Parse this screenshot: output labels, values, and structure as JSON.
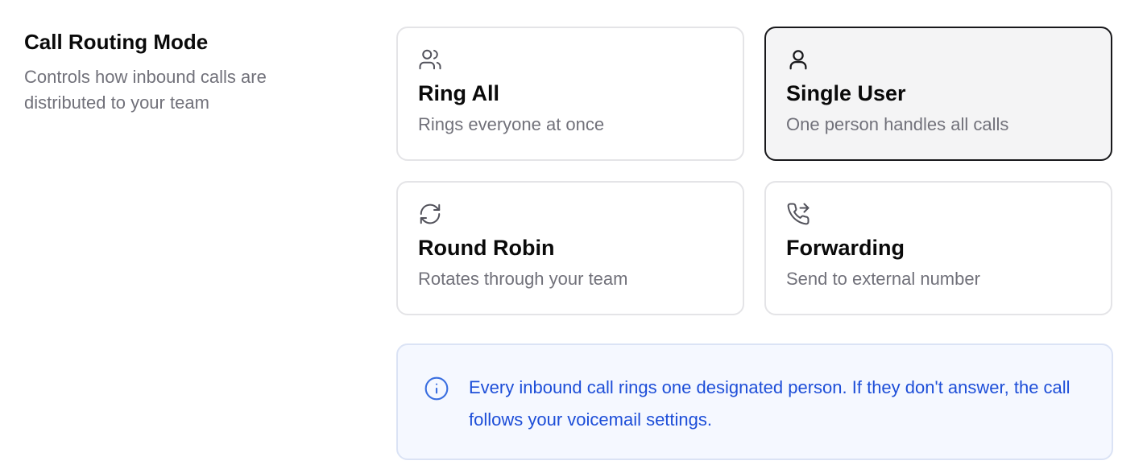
{
  "section": {
    "title": "Call Routing Mode",
    "description": "Controls how inbound calls are distributed to your team"
  },
  "options": [
    {
      "icon": "users-icon",
      "title": "Ring All",
      "description": "Rings everyone at once",
      "selected": false
    },
    {
      "icon": "user-icon",
      "title": "Single User",
      "description": "One person handles all calls",
      "selected": true
    },
    {
      "icon": "refresh-icon",
      "title": "Round Robin",
      "description": "Rotates through your team",
      "selected": false
    },
    {
      "icon": "phone-forward-icon",
      "title": "Forwarding",
      "description": "Send to external number",
      "selected": false
    }
  ],
  "info": {
    "icon": "info-icon",
    "text": "Every inbound call rings one designated person. If they don't answer, the call follows your voicemail settings."
  },
  "colors": {
    "selected_border": "#18181b",
    "selected_background": "#f4f4f5",
    "info_text": "#1d4ed8",
    "info_background": "#f5f8ff"
  }
}
